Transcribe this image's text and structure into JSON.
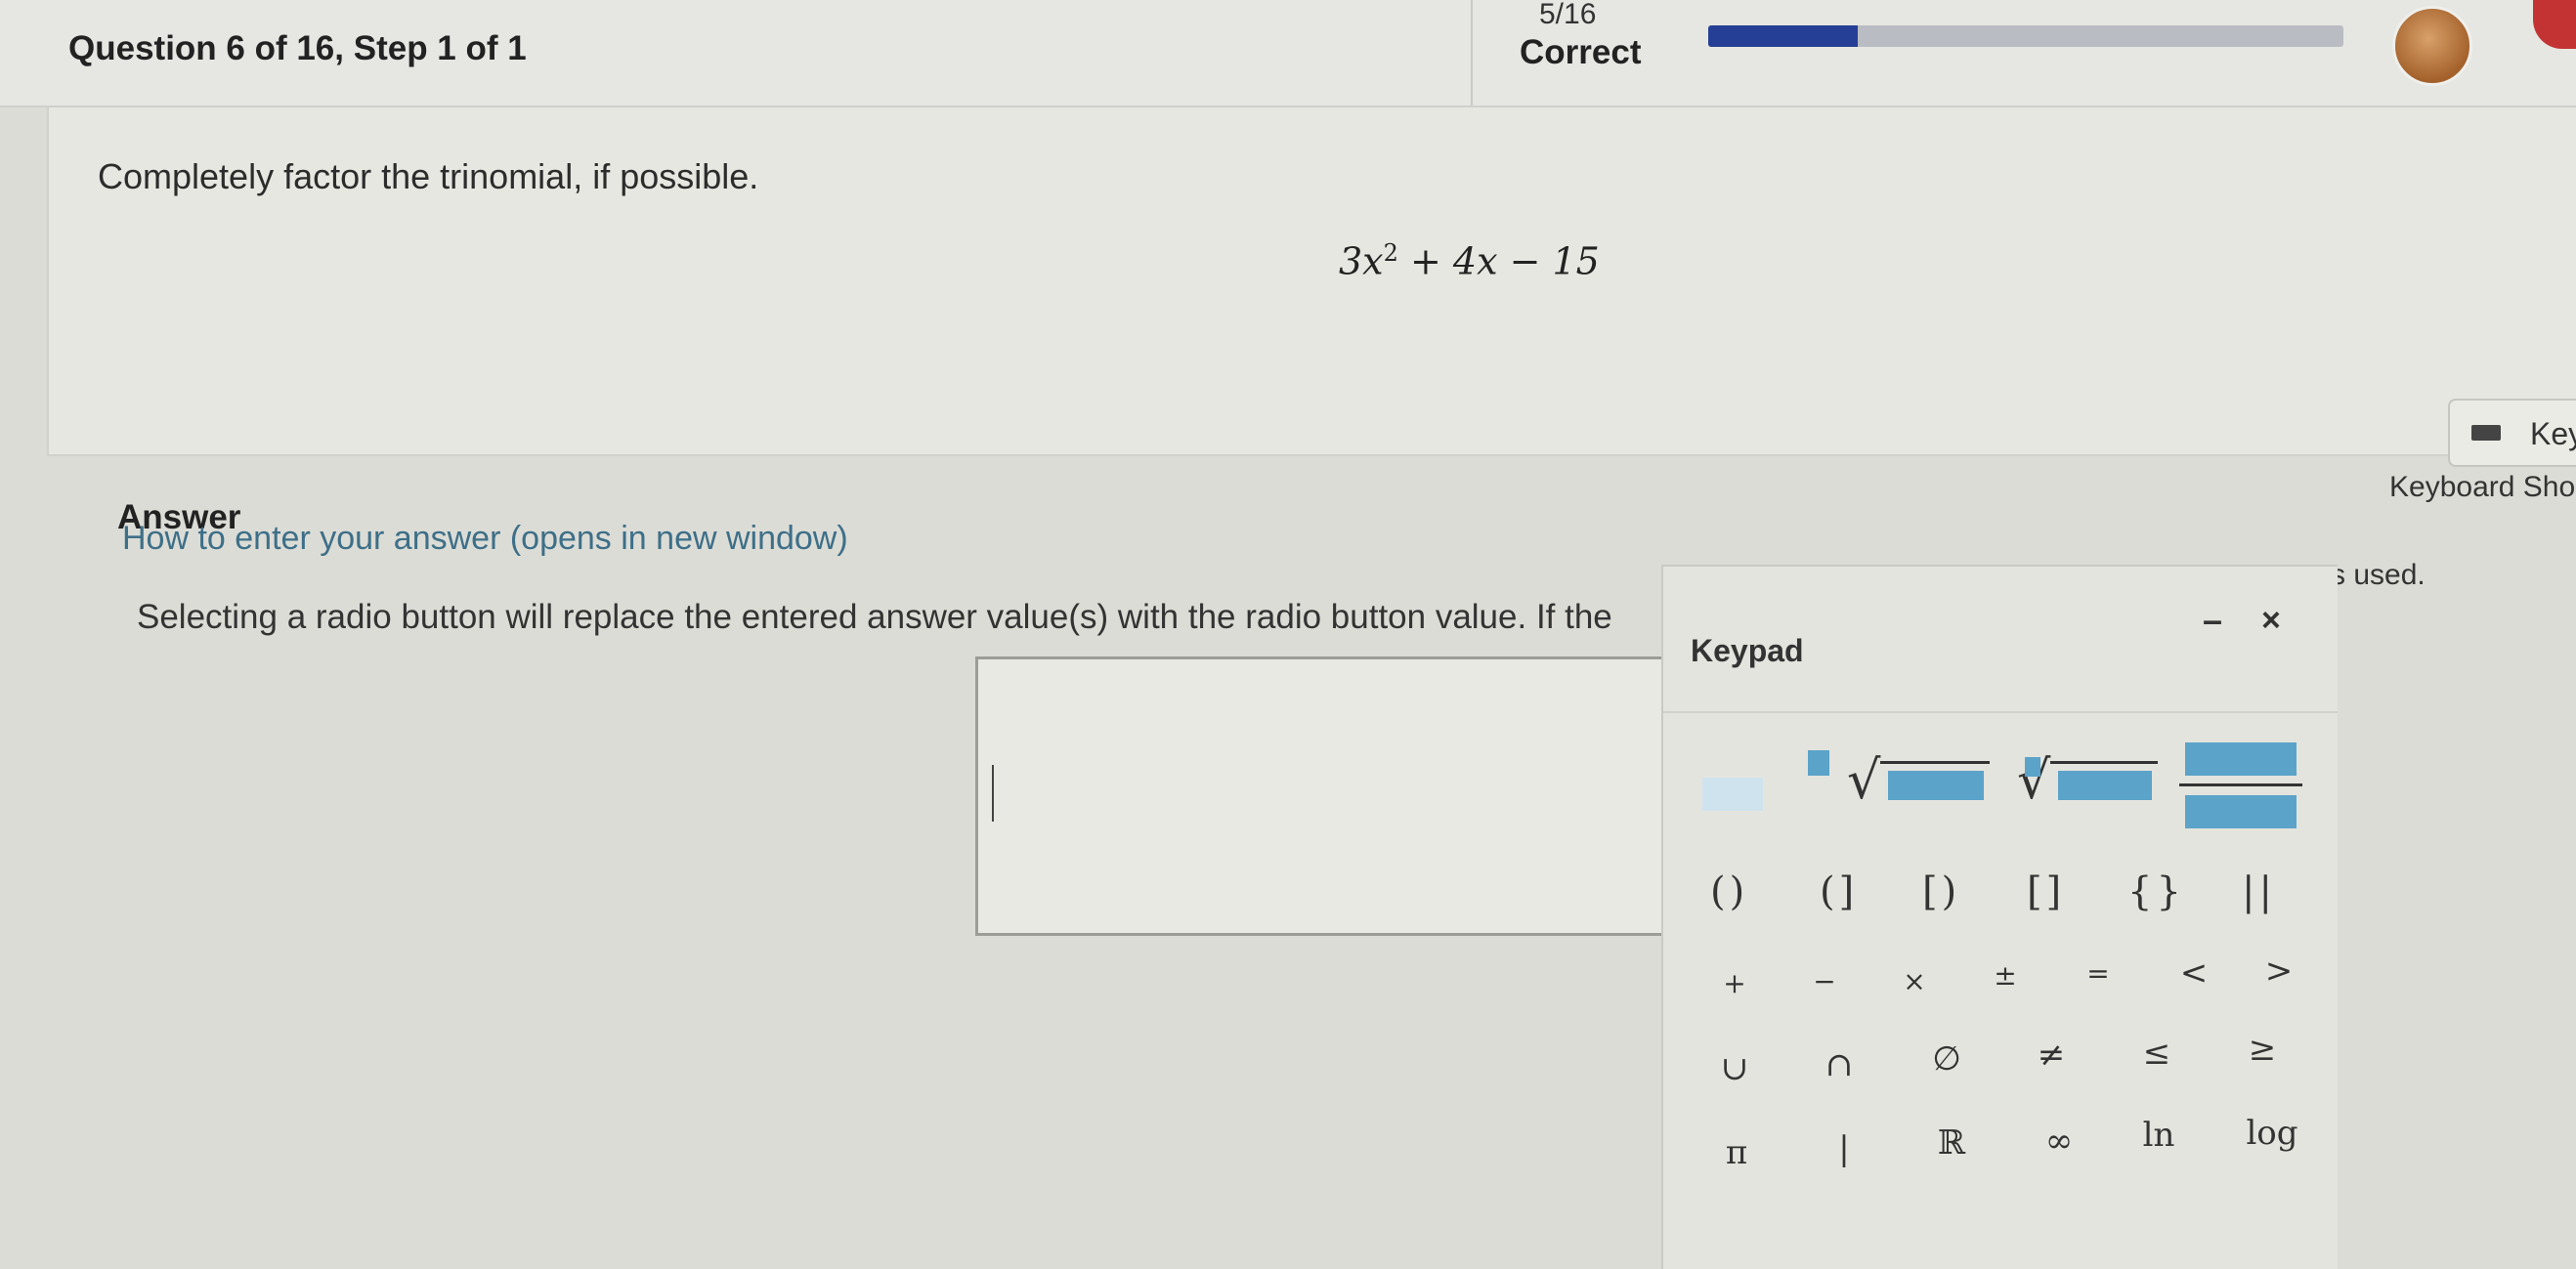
{
  "header": {
    "question_title": "Question 6 of 16, Step 1 of 1",
    "score": "5/16",
    "status": "Correct",
    "progress": 0.235
  },
  "question": {
    "prompt": "Completely factor the trinomial, if possible.",
    "expression": {
      "a": "3x",
      "exp": "2",
      "rest": "+ 4x − 15"
    }
  },
  "answer": {
    "label": "Answer",
    "how_to_link": "How to enter your answer (opens in new window)",
    "radio_note": "Selecting a radio button will replace the entered answer value(s) with the radio button value. If the",
    "used_fragment": "s used."
  },
  "keyboard": {
    "key_button": "Key",
    "shortcuts": "Keyboard Sho"
  },
  "keypad": {
    "title": "Keypad",
    "minimize": "–",
    "close": "×",
    "brackets": [
      "( )",
      "( ]",
      "[ )",
      "[ ]",
      "{ }",
      "| |"
    ],
    "row_ops": [
      "+",
      "−",
      "×",
      "±",
      "=",
      "<",
      ">"
    ],
    "row_sets": [
      "∪",
      "∩",
      "∅",
      "≠",
      "≤",
      "≥"
    ],
    "row_misc": [
      "π",
      "|",
      "ℝ",
      "∞",
      "ln",
      "log"
    ]
  },
  "colors": {
    "progress": "#243f95",
    "template_box": "#5ba3c9",
    "link": "#3d6f88"
  },
  "icons": {
    "keyboard": "keyboard-icon",
    "avatar": "user-avatar"
  }
}
